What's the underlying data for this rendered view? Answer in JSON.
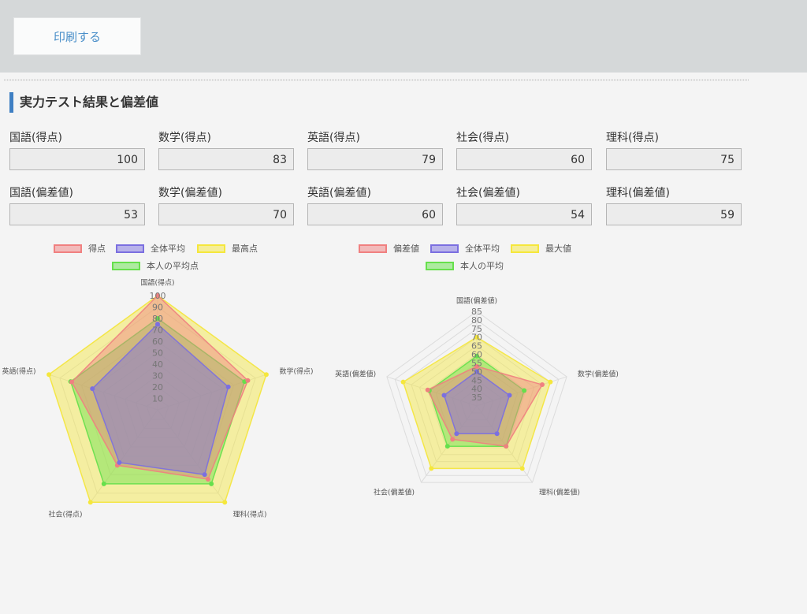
{
  "toolbar": {
    "print_label": "印刷する"
  },
  "section": {
    "title": "実力テスト結果と偏差値"
  },
  "scores": [
    {
      "label": "国語(得点)",
      "value": "100"
    },
    {
      "label": "数学(得点)",
      "value": "83"
    },
    {
      "label": "英語(得点)",
      "value": "79"
    },
    {
      "label": "社会(得点)",
      "value": "60"
    },
    {
      "label": "理科(得点)",
      "value": "75"
    }
  ],
  "deviations": [
    {
      "label": "国語(偏差値)",
      "value": "53"
    },
    {
      "label": "数学(偏差値)",
      "value": "70"
    },
    {
      "label": "英語(偏差値)",
      "value": "60"
    },
    {
      "label": "社会(偏差値)",
      "value": "54"
    },
    {
      "label": "理科(偏差値)",
      "value": "59"
    }
  ],
  "colors": {
    "red": "#f08080",
    "blue": "#7b6fe0",
    "yellow": "#f5e73c",
    "green": "#66e04c"
  },
  "chart_data": [
    {
      "type": "radar",
      "axes": [
        "国語(得点)",
        "数学(得点)",
        "理科(得点)",
        "社会(得点)",
        "英語(得点)"
      ],
      "ticks": [
        "10",
        "20",
        "30",
        "40",
        "50",
        "60",
        "70",
        "80",
        "90",
        "100"
      ],
      "range": [
        0,
        100
      ],
      "legend": [
        "得点",
        "全体平均",
        "最高点",
        "本人の平均点"
      ],
      "series": [
        {
          "name": "得点",
          "color": "#f08080",
          "values": [
            100,
            83,
            75,
            60,
            79
          ]
        },
        {
          "name": "全体平均",
          "color": "#7b6fe0",
          "values": [
            75,
            65,
            70,
            57,
            60
          ]
        },
        {
          "name": "最高点",
          "color": "#f5e73c",
          "values": [
            100,
            100,
            100,
            100,
            100
          ]
        },
        {
          "name": "本人の平均点",
          "color": "#66e04c",
          "values": [
            80,
            80,
            80,
            80,
            80
          ]
        }
      ]
    },
    {
      "type": "radar",
      "axes": [
        "国語(偏差値)",
        "数学(偏差値)",
        "理科(偏差値)",
        "社会(偏差値)",
        "英語(偏差値)"
      ],
      "ticks": [
        "35",
        "40",
        "45",
        "50",
        "55",
        "60",
        "65",
        "70",
        "75",
        "80",
        "85"
      ],
      "range": [
        30,
        85
      ],
      "legend": [
        "偏差値",
        "全体平均",
        "最大値",
        "本人の平均"
      ],
      "series": [
        {
          "name": "偏差値",
          "color": "#f08080",
          "values": [
            53,
            70,
            59,
            54,
            60
          ]
        },
        {
          "name": "全体平均",
          "color": "#7b6fe0",
          "values": [
            50,
            50,
            50,
            50,
            50
          ]
        },
        {
          "name": "最大値",
          "color": "#f5e73c",
          "values": [
            70,
            75,
            75,
            75,
            75
          ]
        },
        {
          "name": "本人の平均",
          "color": "#66e04c",
          "values": [
            59,
            59,
            59,
            59,
            59
          ]
        }
      ]
    }
  ]
}
